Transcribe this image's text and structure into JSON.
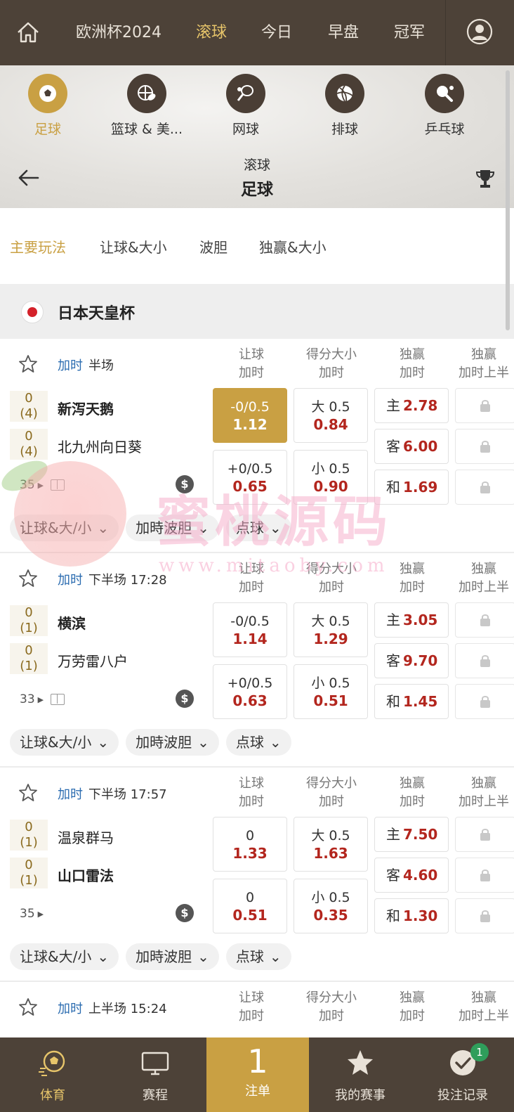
{
  "topnav": {
    "tabs": [
      "欧洲杯2024",
      "滚球",
      "今日",
      "早盘",
      "冠军"
    ],
    "active_tab": "滚球"
  },
  "sports": [
    "足球",
    "篮球 & 美...",
    "网球",
    "排球",
    "乒乓球"
  ],
  "header": {
    "subtitle": "滚球",
    "title": "足球"
  },
  "market_tabs": [
    "主要玩法",
    "让球&大小",
    "波胆",
    "独赢&大小"
  ],
  "league": {
    "name": "日本天皇杯"
  },
  "col_headers": {
    "handicap": [
      "让球",
      "加时"
    ],
    "total": [
      "得分大小",
      "加时"
    ],
    "moneyline": [
      "独赢",
      "加时"
    ],
    "moneyline_half": [
      "独赢",
      "加时上半"
    ]
  },
  "win_keys": {
    "home": "主",
    "away": "客",
    "draw": "和"
  },
  "chips": [
    "让球&大/小",
    "加時波胆",
    "点球"
  ],
  "matches": [
    {
      "ot": "加时",
      "status": "半场",
      "home": {
        "name": "新泻天鹅",
        "score": "0",
        "sub": "(4)"
      },
      "away": {
        "name": "北九州向日葵",
        "score": "0",
        "sub": "(4)"
      },
      "minute": "35",
      "handicap": [
        {
          "line": "-0/0.5",
          "price": "1.12"
        },
        {
          "line": "+0/0.5",
          "price": "0.65"
        }
      ],
      "total": [
        {
          "line": "大 0.5",
          "price": "0.84"
        },
        {
          "line": "小 0.5",
          "price": "0.90"
        }
      ],
      "moneyline": {
        "home": "2.78",
        "away": "6.00",
        "draw": "1.69"
      }
    },
    {
      "ot": "加时",
      "status": "下半场 17:28",
      "home": {
        "name": "横滨",
        "score": "0",
        "sub": "(1)"
      },
      "away": {
        "name": "万劳雷八户",
        "score": "0",
        "sub": "(1)"
      },
      "minute": "33",
      "handicap": [
        {
          "line": "-0/0.5",
          "price": "1.14"
        },
        {
          "line": "+0/0.5",
          "price": "0.63"
        }
      ],
      "total": [
        {
          "line": "大 0.5",
          "price": "1.29"
        },
        {
          "line": "小 0.5",
          "price": "0.51"
        }
      ],
      "moneyline": {
        "home": "3.05",
        "away": "9.70",
        "draw": "1.45"
      }
    },
    {
      "ot": "加时",
      "status": "下半场 17:57",
      "home": {
        "name": "温泉群马",
        "score": "0",
        "sub": "(1)"
      },
      "away": {
        "name": "山口雷法",
        "score": "0",
        "sub": "(1)"
      },
      "minute": "35",
      "handicap": [
        {
          "line": "0",
          "price": "1.33"
        },
        {
          "line": "0",
          "price": "0.51"
        }
      ],
      "total": [
        {
          "line": "大 0.5",
          "price": "1.63"
        },
        {
          "line": "小 0.5",
          "price": "0.35"
        }
      ],
      "moneyline": {
        "home": "7.50",
        "away": "4.60",
        "draw": "1.30"
      }
    },
    {
      "ot": "加时",
      "status": "上半场 15:24"
    }
  ],
  "watermark": {
    "text": "蜜桃源码",
    "url": "www.mitaoby.com"
  },
  "bottomnav": {
    "items": [
      "体育",
      "赛程",
      "注单",
      "我的赛事",
      "投注记录"
    ],
    "slip_count": "1",
    "records_badge": "1"
  },
  "colors": {
    "nav_bg": "#4d4238",
    "gold": "#c9a043",
    "odds_red": "#b3261e",
    "overtime_blue": "#2b6cb0"
  }
}
